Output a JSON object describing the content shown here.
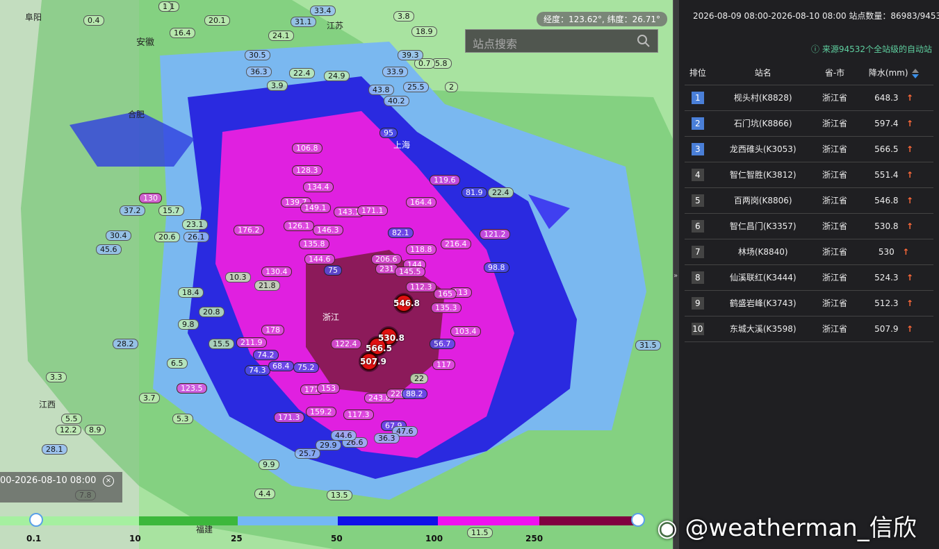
{
  "map": {
    "coord_text": "经度：123.62°, 纬度：26.71°",
    "search_placeholder": "站点搜索",
    "time_range_partial": "00-2026-08-10 08:00",
    "region_labels": [
      "阜阳",
      "安徽",
      "合肥",
      "上海",
      "浙江",
      "江西",
      "福建",
      "江苏"
    ],
    "legend_ticks": [
      "0.1",
      "10",
      "25",
      "50",
      "100",
      "250"
    ],
    "legend_colors": [
      "#a5f0a0",
      "#3cb83c",
      "#74b8f5",
      "#1010e8",
      "#f010f0",
      "#800040"
    ],
    "station_values": [
      "0.1",
      "0.4",
      "16.4",
      "20.1",
      "33.4",
      "31.1",
      "3.8",
      "18.9",
      "24.1",
      "30.5",
      "36.3",
      "22.4",
      "24.9",
      "3.9",
      "5.8",
      "0.7",
      "33.9",
      "39.3",
      "43.8",
      "25.5",
      "2",
      "40.2",
      "95",
      "106.8",
      "128.3",
      "134.4",
      "139.7",
      "149.1",
      "143.1",
      "171.1",
      "164.4",
      "119.6",
      "81.9",
      "22.4",
      "176.2",
      "126.1",
      "146.3",
      "135.8",
      "82.1",
      "118.8",
      "216.4",
      "121.2",
      "98.8",
      "144.6",
      "206.6",
      "144",
      "130.4",
      "75",
      "231",
      "145.5",
      "112.3",
      "113",
      "165",
      "135.3",
      "178",
      "103.4",
      "122.4",
      "56.7",
      "117",
      "211.9",
      "74.2",
      "74.3",
      "68.4",
      "75.2",
      "123.5",
      "177",
      "153",
      "243.8",
      "228.8",
      "88.2",
      "22",
      "171.3",
      "159.2",
      "117.3",
      "67.9",
      "47.6",
      "26.6",
      "36.3",
      "25.7",
      "29.9",
      "44.6",
      "31.5",
      "11.5",
      "8.9",
      "12.2",
      "5.5",
      "28.1",
      "45.6",
      "30.4",
      "37.2",
      "15.7",
      "130",
      "23.1",
      "26.1",
      "20.6",
      "10.3",
      "21.8",
      "18.4",
      "20.8",
      "9.8",
      "15.5",
      "28.2",
      "6.5",
      "3.3",
      "3.7",
      "5.3",
      "7.8",
      "9.9",
      "4.4",
      "13.5",
      "1"
    ],
    "markers": [
      {
        "label": "546.8"
      },
      {
        "label": "530.8"
      },
      {
        "label": "566.5"
      },
      {
        "label": "507.9"
      }
    ]
  },
  "panel": {
    "header": "2026-08-09 08:00-2026-08-10 08:00  站点数量：86983/94532",
    "source_note": "来源94532个全站级的自动站",
    "columns": [
      "排位",
      "站名",
      "省-市",
      "降水(mm)"
    ],
    "rows": [
      {
        "rank": "1",
        "name": "枧头村(K8828)",
        "prov": "浙江省",
        "value": "648.3",
        "trend": "↑"
      },
      {
        "rank": "2",
        "name": "石门坑(K8866)",
        "prov": "浙江省",
        "value": "597.4",
        "trend": "↑"
      },
      {
        "rank": "3",
        "name": "龙西碓头(K3053)",
        "prov": "浙江省",
        "value": "566.5",
        "trend": "↑"
      },
      {
        "rank": "4",
        "name": "智仁智胜(K3812)",
        "prov": "浙江省",
        "value": "551.4",
        "trend": "↑"
      },
      {
        "rank": "5",
        "name": "百两岗(K8806)",
        "prov": "浙江省",
        "value": "546.8",
        "trend": "↑"
      },
      {
        "rank": "6",
        "name": "智仁昌门(K3357)",
        "prov": "浙江省",
        "value": "530.8",
        "trend": "↑"
      },
      {
        "rank": "7",
        "name": "林场(K8840)",
        "prov": "浙江省",
        "value": "530",
        "trend": "↑"
      },
      {
        "rank": "8",
        "name": "仙溪联红(K3444)",
        "prov": "浙江省",
        "value": "524.3",
        "trend": "↑"
      },
      {
        "rank": "9",
        "name": "鹤盛岩峰(K3743)",
        "prov": "浙江省",
        "value": "512.3",
        "trend": "↑"
      },
      {
        "rank": "10",
        "name": "东城大溪(K3598)",
        "prov": "浙江省",
        "value": "507.9",
        "trend": "↑"
      }
    ]
  },
  "watermark": "@weatherman_信欣"
}
